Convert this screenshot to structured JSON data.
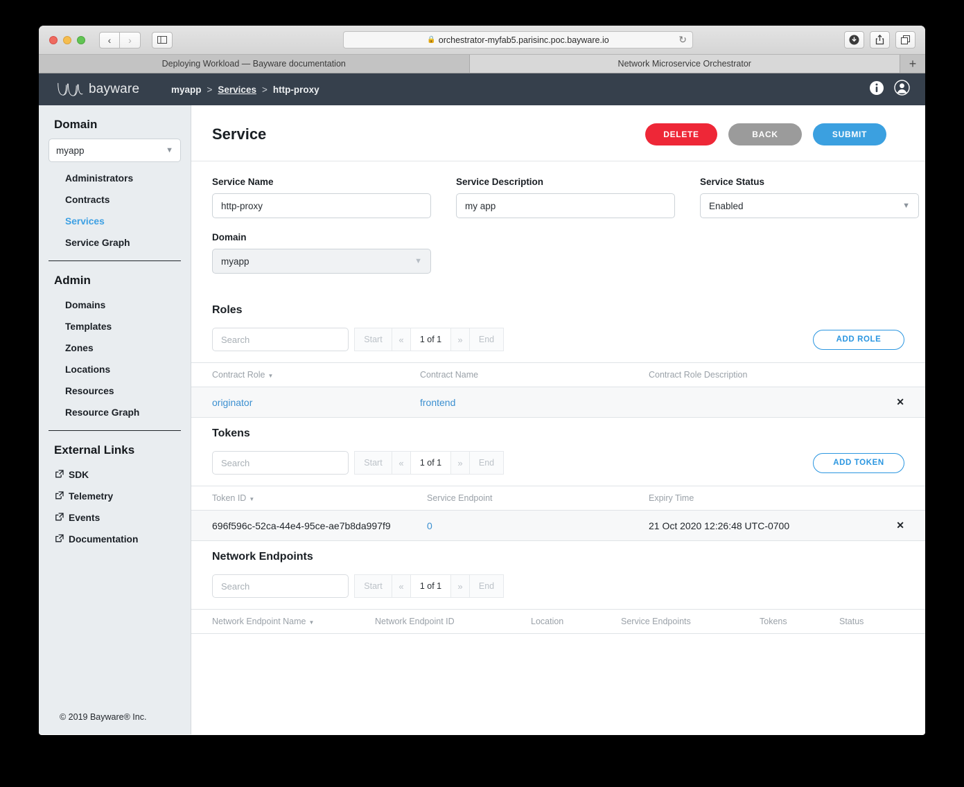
{
  "browser": {
    "url": "orchestrator-myfab5.parisinc.poc.bayware.io",
    "lock_icon": "lock-icon",
    "reload_icon": "reload-icon",
    "back_icon": "chevron-left-icon",
    "forward_icon": "chevron-right-icon",
    "sidebar_icon": "sidebar-toggle-icon",
    "download_icon": "download-icon",
    "share_icon": "share-icon",
    "tabs_icon": "tab-overview-icon",
    "new_tab_label": "+",
    "tabs": [
      {
        "label": "Deploying Workload — Bayware documentation",
        "active": false
      },
      {
        "label": "Network Microservice Orchestrator",
        "active": true
      }
    ]
  },
  "header": {
    "brand": "bayware",
    "breadcrumb": {
      "domain": "myapp",
      "sep1": ">",
      "section": "Services",
      "sep2": ">",
      "current": "http-proxy"
    },
    "info_icon": "info-icon",
    "account_icon": "user-account-icon"
  },
  "sidebar": {
    "domain_heading": "Domain",
    "domain_value": "myapp",
    "domain_chevron": "chevron-down-icon",
    "domain_links": [
      {
        "label": "Administrators",
        "active": false
      },
      {
        "label": "Contracts",
        "active": false
      },
      {
        "label": "Services",
        "active": true
      },
      {
        "label": "Service Graph",
        "active": false
      }
    ],
    "admin_heading": "Admin",
    "admin_links": [
      {
        "label": "Domains"
      },
      {
        "label": "Templates"
      },
      {
        "label": "Zones"
      },
      {
        "label": "Locations"
      },
      {
        "label": "Resources"
      },
      {
        "label": "Resource Graph"
      }
    ],
    "external_heading": "External Links",
    "external_links": [
      {
        "label": "SDK",
        "icon": "external-link-icon"
      },
      {
        "label": "Telemetry",
        "icon": "external-link-icon"
      },
      {
        "label": "Events",
        "icon": "external-link-icon"
      },
      {
        "label": "Documentation",
        "icon": "external-link-icon"
      }
    ],
    "footer": "© 2019 Bayware® Inc."
  },
  "page": {
    "title": "Service",
    "buttons": {
      "delete": "DELETE",
      "back": "BACK",
      "submit": "SUBMIT"
    },
    "colors": {
      "delete": "#ee2737",
      "back": "#9b9b9b",
      "submit": "#3ba0e0",
      "accent": "#2b96e0",
      "header_bg": "#36404c",
      "sidebar_bg": "#e9edf0"
    },
    "fields": {
      "service_name_label": "Service Name",
      "service_name_value": "http-proxy",
      "service_description_label": "Service Description",
      "service_description_value": "my app",
      "service_status_label": "Service Status",
      "service_status_value": "Enabled",
      "domain_label": "Domain",
      "domain_value": "myapp",
      "chevron": "chevron-down-icon"
    }
  },
  "common": {
    "search_placeholder": "Search",
    "pager": {
      "start": "Start",
      "prev": "«",
      "count": "1 of 1",
      "next": "»",
      "end": "End"
    },
    "delete_row_icon": "delete-row-icon",
    "sort_caret": "▾"
  },
  "roles": {
    "title": "Roles",
    "add_label": "ADD ROLE",
    "columns": [
      "Contract Role",
      "Contract Name",
      "Contract Role Description"
    ],
    "rows": [
      {
        "contract_role": "originator",
        "contract_name": "frontend",
        "description": ""
      }
    ]
  },
  "tokens": {
    "title": "Tokens",
    "add_label": "ADD TOKEN",
    "columns": [
      "Token ID",
      "Service Endpoint",
      "Expiry Time"
    ],
    "rows": [
      {
        "token_id": "696f596c-52ca-44e4-95ce-ae7b8da997f9",
        "service_endpoint": "0",
        "expiry_time": "21 Oct 2020 12:26:48 UTC-0700"
      }
    ]
  },
  "network_endpoints": {
    "title": "Network Endpoints",
    "columns": [
      "Network Endpoint Name",
      "Network Endpoint ID",
      "Location",
      "Service Endpoints",
      "Tokens",
      "Status"
    ],
    "rows": []
  }
}
